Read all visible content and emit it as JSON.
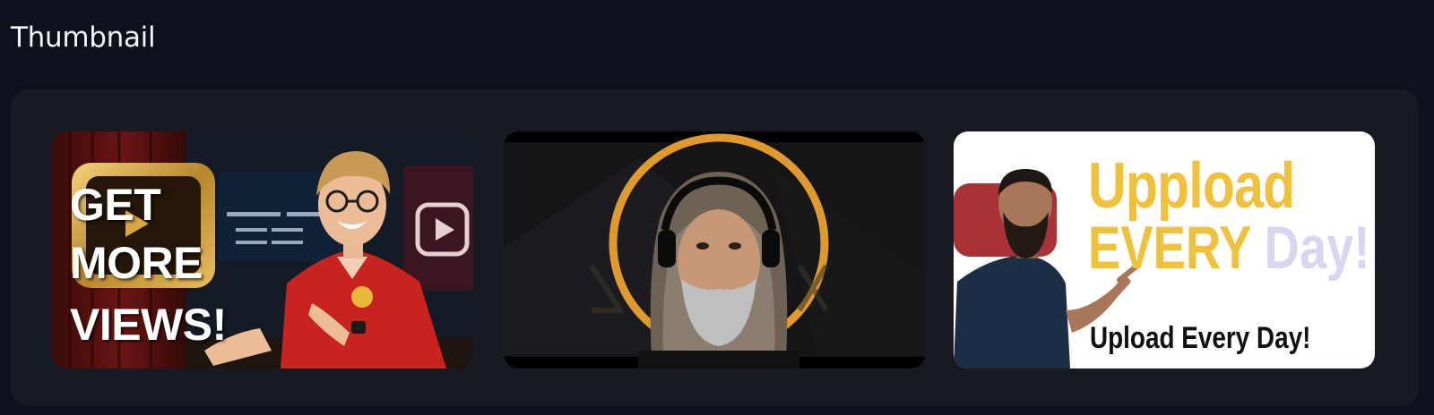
{
  "section": {
    "title": "Thumbnail"
  },
  "thumbnails": [
    {
      "lines": [
        "GET",
        "MORE",
        "VIEWS!"
      ]
    },
    {
      "lines": []
    },
    {
      "line1": "Uppload",
      "line2_a": "EVERY",
      "line2_b": "Day!",
      "caption": "Upload Every Day!"
    }
  ],
  "colors": {
    "page_bg": "#0c111b",
    "panel_bg": "#171a23",
    "accent_gold": "#f0c23c",
    "shirt_red": "#c8231e"
  },
  "icons": [
    "play-logo-icon",
    "youtube-play-icon",
    "headphones-icon"
  ]
}
